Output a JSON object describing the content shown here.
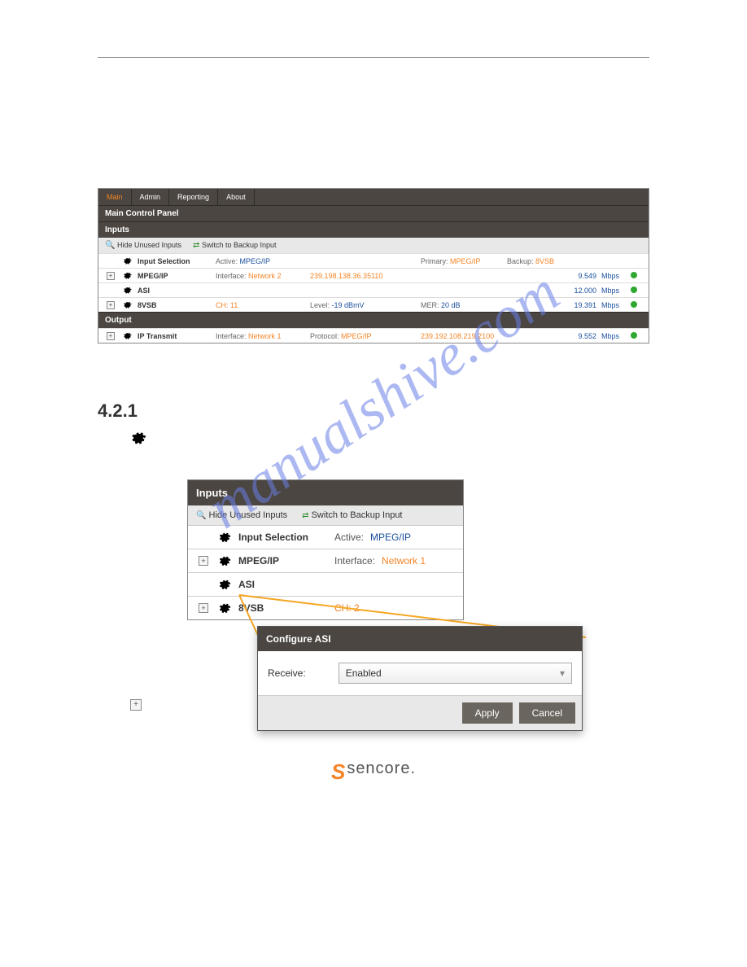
{
  "watermark": "manualshive.com",
  "tabs": [
    "Main",
    "Admin",
    "Reporting",
    "About"
  ],
  "panel_title": "Main Control Panel",
  "inputs_header": "Inputs",
  "toolbar": {
    "hide": "Hide Unused Inputs",
    "switch": "Switch to Backup Input"
  },
  "rows": {
    "sel": {
      "name": "Input Selection",
      "active_lbl": "Active:",
      "active_val": "MPEG/IP",
      "primary_lbl": "Primary:",
      "primary_val": "MPEG/IP",
      "backup_lbl": "Backup:",
      "backup_val": "8VSB"
    },
    "mpeg": {
      "name": "MPEG/IP",
      "iface_lbl": "Interface:",
      "iface_val": "Network 2",
      "addr": "239.198.138.36.35110",
      "rate": "9.549",
      "unit": "Mbps"
    },
    "asi": {
      "name": "ASI",
      "rate": "12.000",
      "unit": "Mbps"
    },
    "vsb": {
      "name": "8VSB",
      "ch_lbl": "CH:",
      "ch_val": "11",
      "level_lbl": "Level:",
      "level_val": "-19 dBmV",
      "mer_lbl": "MER:",
      "mer_val": "20 dB",
      "rate": "19.391",
      "unit": "Mbps"
    }
  },
  "output_header": "Output",
  "out": {
    "name": "IP Transmit",
    "iface_lbl": "Interface:",
    "iface_val": "Network 1",
    "proto_lbl": "Protocol:",
    "proto_val": "MPEG/IP",
    "addr": "239.192.108.219.2100",
    "rate": "9.552",
    "unit": "Mbps"
  },
  "section_num": "4.2.1",
  "fig2": {
    "header": "Inputs",
    "hide": "Hide Unused Inputs",
    "switch": "Switch to Backup Input",
    "sel_name": "Input Selection",
    "sel_active_lbl": "Active:",
    "sel_active_val": "MPEG/IP",
    "mpeg_name": "MPEG/IP",
    "mpeg_iface_lbl": "Interface:",
    "mpeg_iface_val": "Network 1",
    "asi_name": "ASI",
    "vsb_name": "8VSB",
    "vsb_ch": "CH: 2"
  },
  "dialog": {
    "title": "Configure ASI",
    "recv_lbl": "Receive:",
    "recv_val": "Enabled",
    "apply": "Apply",
    "cancel": "Cancel"
  },
  "logo": {
    "s": "S",
    "name": "sencore."
  }
}
